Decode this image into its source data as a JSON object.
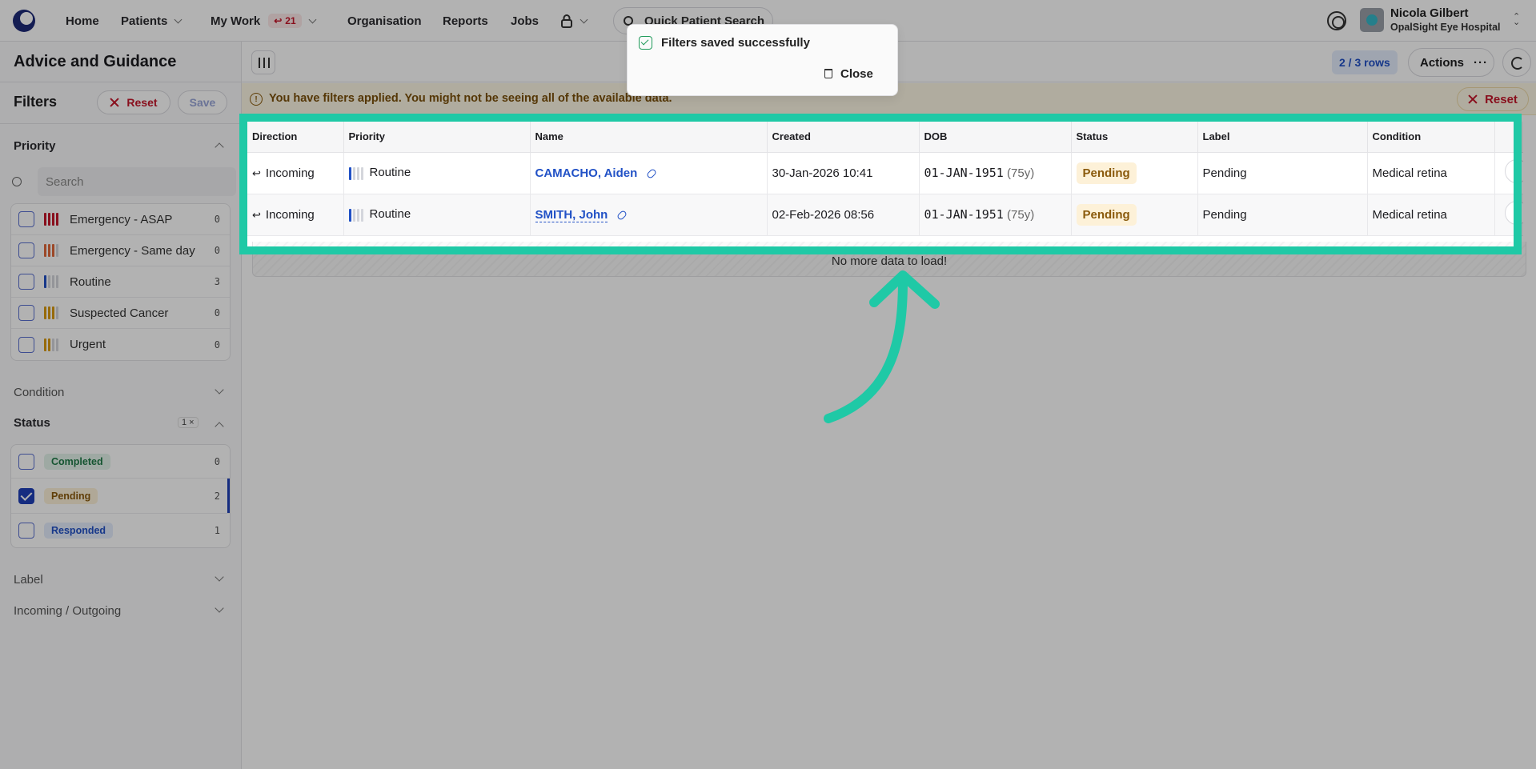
{
  "nav": {
    "home": "Home",
    "patients": "Patients",
    "my_work": "My Work",
    "my_work_badge": "21",
    "organisation": "Organisation",
    "reports": "Reports",
    "jobs": "Jobs",
    "search_placeholder": "Quick Patient Search",
    "user_name": "Nicola Gilbert",
    "user_org": "OpalSight Eye Hospital"
  },
  "toast": {
    "message": "Filters saved successfully",
    "close_label": "Close"
  },
  "sidebar": {
    "page_title": "Advice and Guidance",
    "filters_title": "Filters",
    "reset_label": "Reset",
    "save_label": "Save",
    "priority": {
      "title": "Priority",
      "search_placeholder": "Search",
      "options": [
        {
          "label": "Emergency - ASAP",
          "count": "0",
          "color": "#c4162a",
          "filled": 4
        },
        {
          "label": "Emergency - Same day",
          "count": "0",
          "color": "#e0673a",
          "filled": 3
        },
        {
          "label": "Routine",
          "count": "3",
          "color": "#2151c6",
          "filled": 1
        },
        {
          "label": "Suspected Cancer",
          "count": "0",
          "color": "#d99a10",
          "filled": 3
        },
        {
          "label": "Urgent",
          "count": "0",
          "color": "#d99a10",
          "filled": 2
        }
      ]
    },
    "condition": {
      "title": "Condition"
    },
    "status": {
      "title": "Status",
      "active_count": "1",
      "options": [
        {
          "label": "Completed",
          "count": "0",
          "checked": false,
          "tone": "green"
        },
        {
          "label": "Pending",
          "count": "2",
          "checked": true,
          "tone": "amber"
        },
        {
          "label": "Responded",
          "count": "1",
          "checked": false,
          "tone": "blue"
        }
      ]
    },
    "label": {
      "title": "Label"
    },
    "incoming_outgoing": {
      "title": "Incoming / Outgoing"
    }
  },
  "toolbar": {
    "rows": "2 / 3 rows",
    "actions_label": "Actions"
  },
  "warning": {
    "text": "You have filters applied. You might not be seeing all of the available data.",
    "reset_label": "Reset"
  },
  "table": {
    "columns": [
      "Direction",
      "Priority",
      "Name",
      "Created",
      "DOB",
      "Status",
      "Label",
      "Condition"
    ],
    "rows": [
      {
        "direction": "Incoming",
        "priority": "Routine",
        "name": "CAMACHO, Aiden",
        "created": "30-Jan-2026 10:41",
        "dob": "01-JAN-1951",
        "age": "(75y)",
        "status": "Pending",
        "label": "Pending",
        "condition": "Medical retina"
      },
      {
        "direction": "Incoming",
        "priority": "Routine",
        "name": "SMITH, John",
        "created": "02-Feb-2026 08:56",
        "dob": "01-JAN-1951",
        "age": "(75y)",
        "status": "Pending",
        "label": "Pending",
        "condition": "Medical retina"
      }
    ],
    "no_more": "No more data to load!"
  },
  "colors": {
    "highlight": "#1fc9a6",
    "accent": "#2151c6",
    "danger": "#c4162a"
  }
}
